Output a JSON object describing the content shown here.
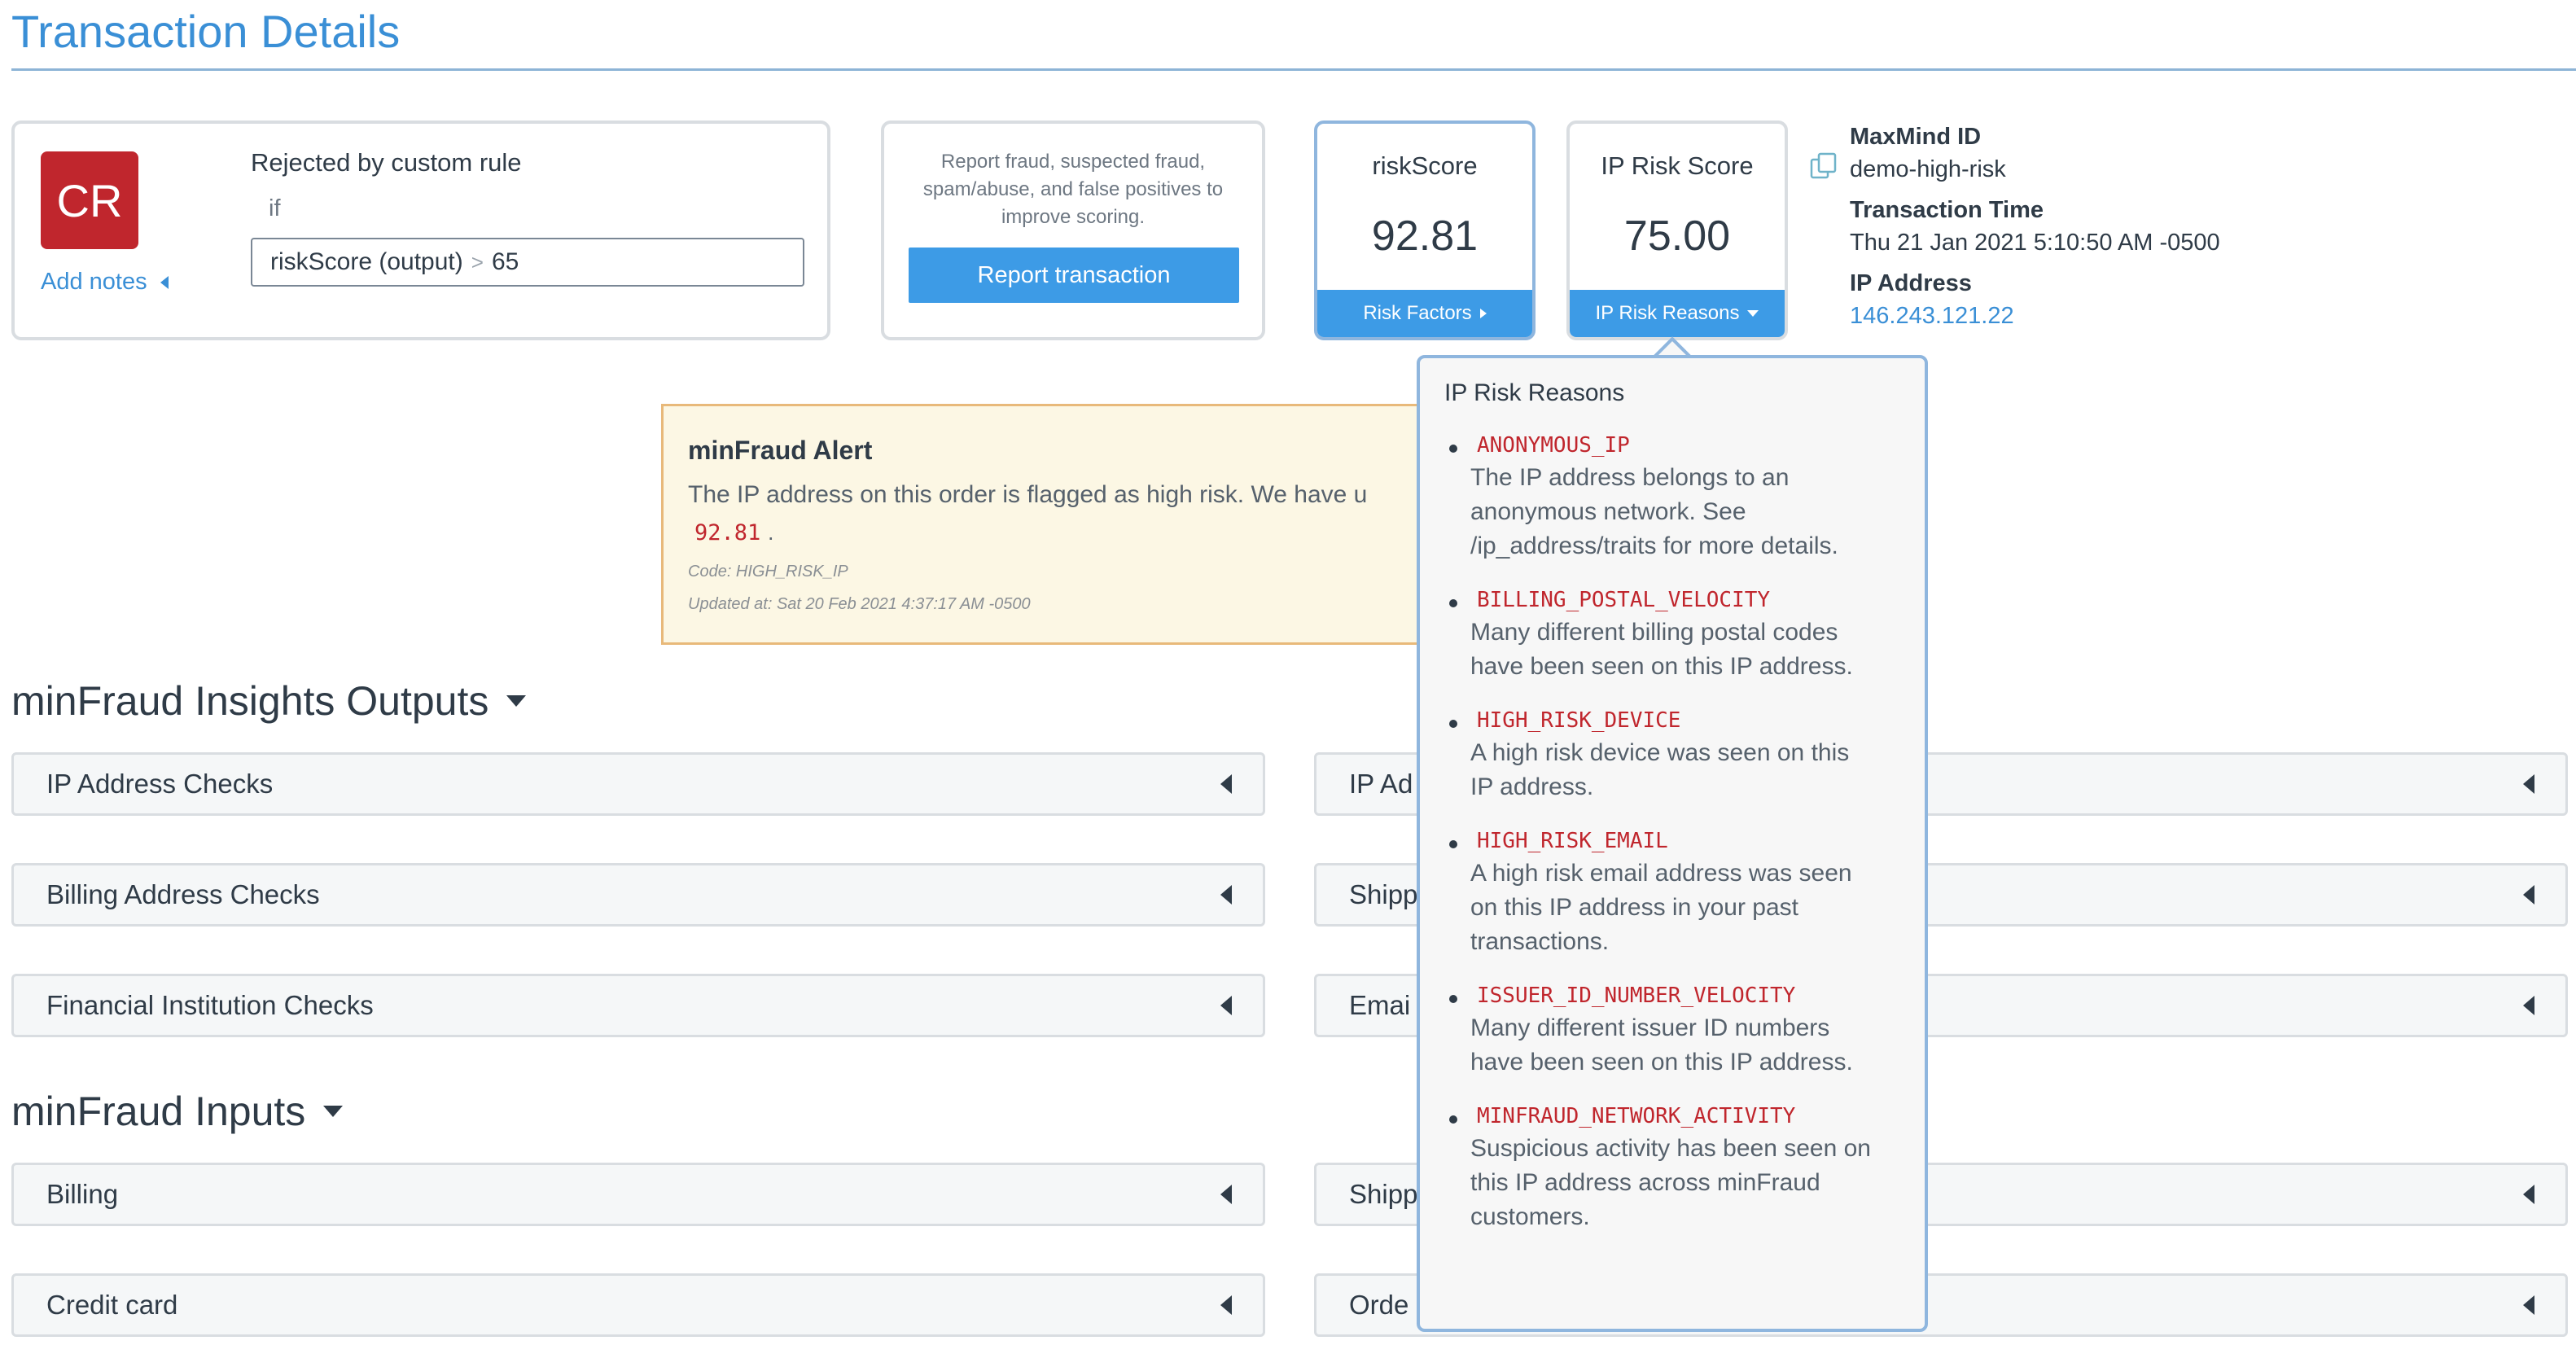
{
  "page": {
    "title": "Transaction Details"
  },
  "rule_card": {
    "avatar": "CR",
    "add_notes": "Add notes",
    "label": "Rejected by custom rule",
    "if_text": "if",
    "condition_field": "riskScore (output)",
    "condition_operator": ">",
    "condition_value": "65"
  },
  "report_card": {
    "text": "Report fraud, suspected fraud, spam/abuse, and false positives to improve scoring.",
    "button": "Report transaction"
  },
  "risk_score": {
    "title": "riskScore",
    "value": "92.81",
    "footer": "Risk Factors"
  },
  "ip_risk_score": {
    "title": "IP Risk Score",
    "value": "75.00",
    "footer": "IP Risk Reasons"
  },
  "meta": {
    "maxmind_id_label": "MaxMind ID",
    "maxmind_id": "demo-high-risk",
    "transaction_time_label": "Transaction Time",
    "transaction_time": "Thu 21 Jan 2021 5:10:50 AM -0500",
    "ip_address_label": "IP Address",
    "ip_address": "146.243.121.22"
  },
  "alert": {
    "title": "minFraud Alert",
    "text": "The IP address on this order is flagged as high risk. We have u",
    "score": "92.81",
    "score_suffix": ".",
    "code": "Code: HIGH_RISK_IP",
    "updated": "Updated at: Sat 20 Feb 2021 4:37:17 AM -0500"
  },
  "insights": {
    "title": "minFraud Insights Outputs",
    "left": [
      "IP Address Checks",
      "Billing Address Checks",
      "Financial Institution Checks"
    ],
    "right": [
      "IP Ad",
      "Shipp",
      "Emai"
    ]
  },
  "inputs": {
    "title": "minFraud Inputs",
    "left": [
      "Billing",
      "Credit card"
    ],
    "right": [
      "Shipp",
      "Orde"
    ]
  },
  "popover": {
    "title": "IP Risk Reasons",
    "items": [
      {
        "code": "ANONYMOUS_IP",
        "desc": [
          "The IP address belongs to an",
          "anonymous network. See",
          "/ip_address/traits for more details."
        ]
      },
      {
        "code": "BILLING_POSTAL_VELOCITY",
        "desc": [
          "Many different billing postal codes",
          "have been seen on this IP address."
        ]
      },
      {
        "code": "HIGH_RISK_DEVICE",
        "desc": [
          "A high risk device was seen on this",
          "IP address."
        ]
      },
      {
        "code": "HIGH_RISK_EMAIL",
        "desc": [
          "A high risk email address was seen",
          "on this IP address in your past",
          "transactions."
        ]
      },
      {
        "code": "ISSUER_ID_NUMBER_VELOCITY",
        "desc": [
          "Many different issuer ID numbers",
          "have been seen on this IP address."
        ]
      },
      {
        "code": "MINFRAUD_NETWORK_ACTIVITY",
        "desc": [
          "Suspicious activity has been seen on",
          "this IP address across minFraud",
          "customers."
        ]
      }
    ]
  }
}
